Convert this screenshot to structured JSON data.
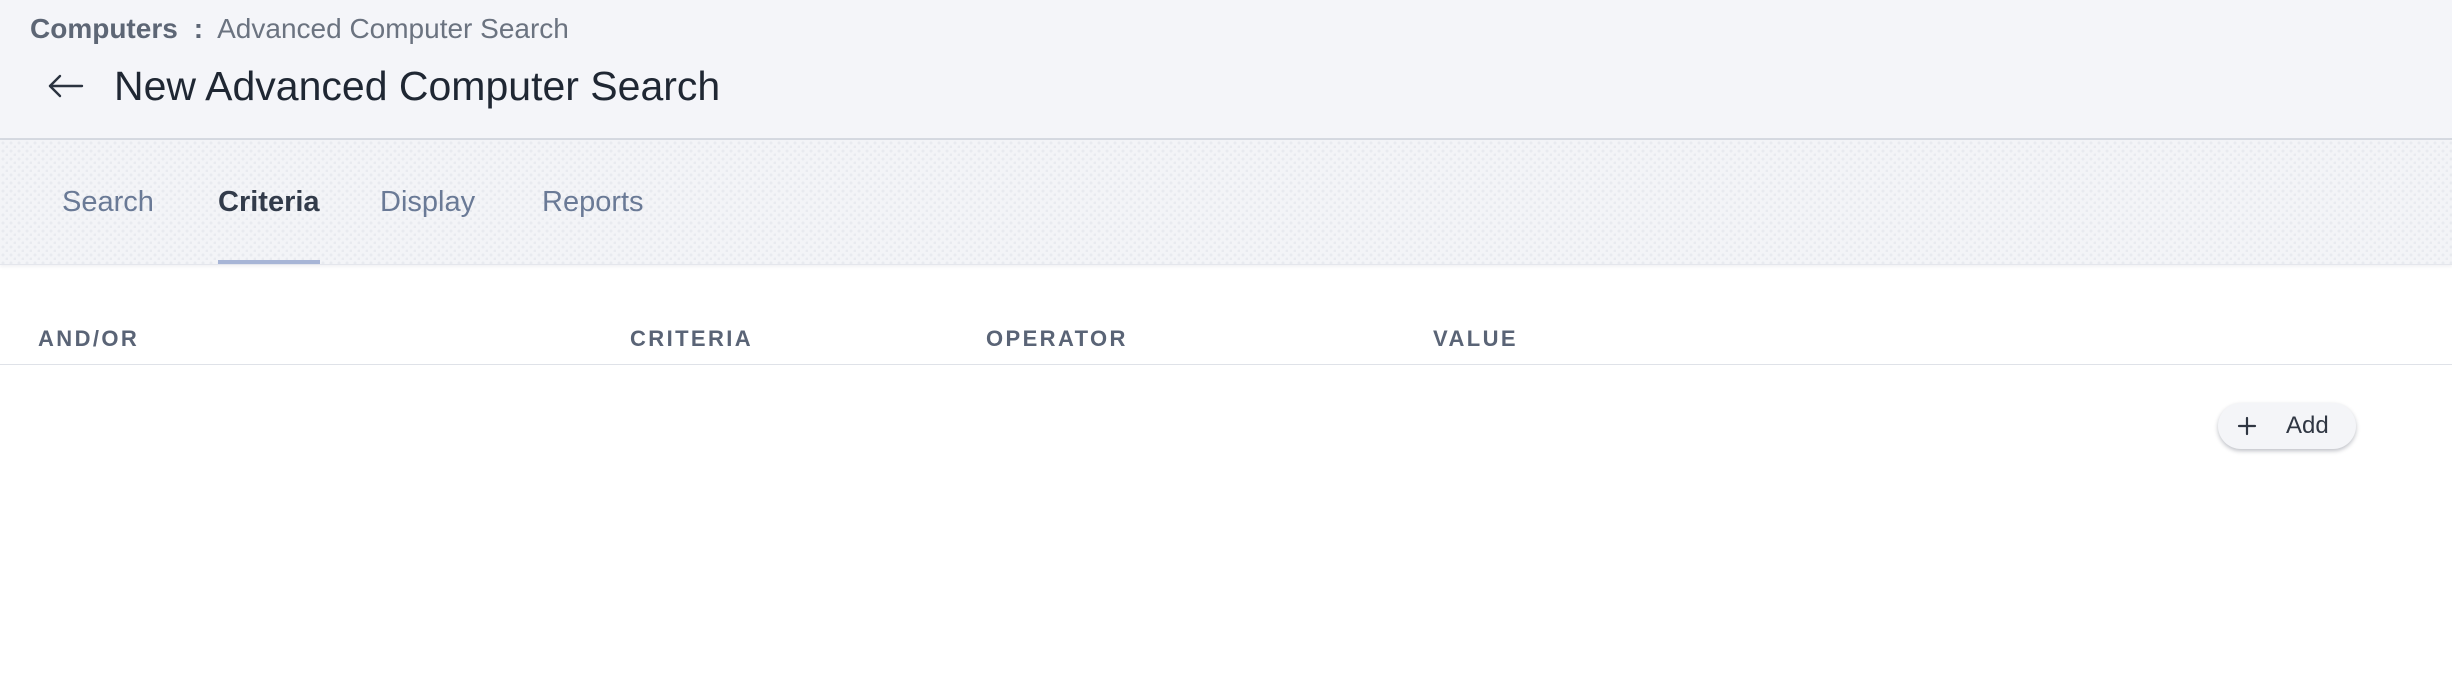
{
  "breadcrumb": {
    "root": "Computers",
    "separator": ":",
    "current": "Advanced Computer Search"
  },
  "header": {
    "back_icon": "arrow-left-icon",
    "title": "New Advanced Computer Search"
  },
  "tabs": [
    {
      "label": "Search",
      "active": false
    },
    {
      "label": "Criteria",
      "active": true
    },
    {
      "label": "Display",
      "active": false
    },
    {
      "label": "Reports",
      "active": false
    }
  ],
  "criteria_table": {
    "columns": [
      "AND/OR",
      "CRITERIA",
      "OPERATOR",
      "VALUE"
    ],
    "rows": []
  },
  "add_button": {
    "icon": "plus-icon",
    "label": "Add"
  },
  "colors": {
    "header_bg": "#f4f5f9",
    "active_tab_underline": "#a7b5d6",
    "inactive_tab_text": "#6a7a96",
    "active_tab_text": "#323b4a"
  }
}
